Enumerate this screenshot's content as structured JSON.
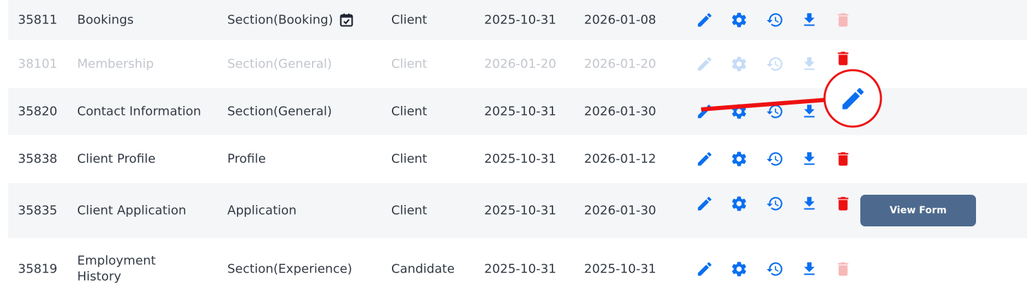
{
  "colors": {
    "action_blue": "#0a6ff0",
    "action_blue_disabled": "#c5dcf7",
    "delete_red": "#ee1111",
    "delete_red_disabled": "#f7b8b8",
    "button_bg": "#4d6a8e",
    "annotation_red": "#ee1111"
  },
  "rows": [
    {
      "id": "35811",
      "name": "Bookings",
      "type": "Section",
      "type_detail": "(Booking)",
      "type_icon": "calendar-check-icon",
      "owner": "Client",
      "created": "2025-10-31",
      "updated": "2026-01-08",
      "state": "active",
      "delete_enabled": false
    },
    {
      "id": "38101",
      "name": "Membership",
      "type": "Section",
      "type_detail": "(General)",
      "owner": "Client",
      "created": "2026-01-20",
      "updated": "2026-01-20",
      "state": "disabled",
      "delete_enabled": true
    },
    {
      "id": "35820",
      "name": "Contact Information",
      "type": "Section",
      "type_detail": "(General)",
      "owner": "Client",
      "created": "2025-10-31",
      "updated": "2026-01-30",
      "state": "active",
      "delete_enabled": false
    },
    {
      "id": "35838",
      "name": "Client Profile",
      "type": "Profile",
      "type_detail": "",
      "owner": "Client",
      "created": "2025-10-31",
      "updated": "2026-01-12",
      "state": "active",
      "delete_enabled": true
    },
    {
      "id": "35835",
      "name": "Client Application",
      "type": "Application",
      "type_detail": "",
      "owner": "Client",
      "created": "2025-10-31",
      "updated": "2026-01-30",
      "state": "active",
      "delete_enabled": true,
      "button_label": "View Form"
    },
    {
      "id": "35819",
      "name": "Employment History",
      "type": "Section",
      "type_detail": "(Experience)",
      "owner": "Candidate",
      "created": "2025-10-31",
      "updated": "2025-10-31",
      "state": "active",
      "delete_enabled": false
    }
  ],
  "annotation": {
    "icon": "pencil-icon",
    "target_row": "35820",
    "marker": "red-circle-with-arrow"
  }
}
